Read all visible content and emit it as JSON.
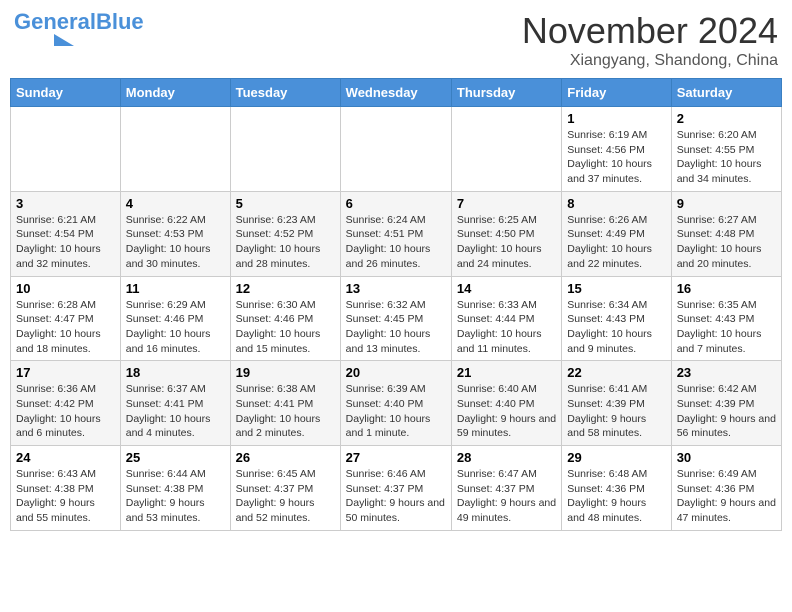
{
  "logo": {
    "general": "General",
    "blue": "Blue",
    "tagline": ""
  },
  "header": {
    "month": "November 2024",
    "location": "Xiangyang, Shandong, China"
  },
  "days_of_week": [
    "Sunday",
    "Monday",
    "Tuesday",
    "Wednesday",
    "Thursday",
    "Friday",
    "Saturday"
  ],
  "weeks": [
    {
      "days": [
        {
          "num": "",
          "info": ""
        },
        {
          "num": "",
          "info": ""
        },
        {
          "num": "",
          "info": ""
        },
        {
          "num": "",
          "info": ""
        },
        {
          "num": "",
          "info": ""
        },
        {
          "num": "1",
          "info": "Sunrise: 6:19 AM\nSunset: 4:56 PM\nDaylight: 10 hours and 37 minutes."
        },
        {
          "num": "2",
          "info": "Sunrise: 6:20 AM\nSunset: 4:55 PM\nDaylight: 10 hours and 34 minutes."
        }
      ]
    },
    {
      "days": [
        {
          "num": "3",
          "info": "Sunrise: 6:21 AM\nSunset: 4:54 PM\nDaylight: 10 hours and 32 minutes."
        },
        {
          "num": "4",
          "info": "Sunrise: 6:22 AM\nSunset: 4:53 PM\nDaylight: 10 hours and 30 minutes."
        },
        {
          "num": "5",
          "info": "Sunrise: 6:23 AM\nSunset: 4:52 PM\nDaylight: 10 hours and 28 minutes."
        },
        {
          "num": "6",
          "info": "Sunrise: 6:24 AM\nSunset: 4:51 PM\nDaylight: 10 hours and 26 minutes."
        },
        {
          "num": "7",
          "info": "Sunrise: 6:25 AM\nSunset: 4:50 PM\nDaylight: 10 hours and 24 minutes."
        },
        {
          "num": "8",
          "info": "Sunrise: 6:26 AM\nSunset: 4:49 PM\nDaylight: 10 hours and 22 minutes."
        },
        {
          "num": "9",
          "info": "Sunrise: 6:27 AM\nSunset: 4:48 PM\nDaylight: 10 hours and 20 minutes."
        }
      ]
    },
    {
      "days": [
        {
          "num": "10",
          "info": "Sunrise: 6:28 AM\nSunset: 4:47 PM\nDaylight: 10 hours and 18 minutes."
        },
        {
          "num": "11",
          "info": "Sunrise: 6:29 AM\nSunset: 4:46 PM\nDaylight: 10 hours and 16 minutes."
        },
        {
          "num": "12",
          "info": "Sunrise: 6:30 AM\nSunset: 4:46 PM\nDaylight: 10 hours and 15 minutes."
        },
        {
          "num": "13",
          "info": "Sunrise: 6:32 AM\nSunset: 4:45 PM\nDaylight: 10 hours and 13 minutes."
        },
        {
          "num": "14",
          "info": "Sunrise: 6:33 AM\nSunset: 4:44 PM\nDaylight: 10 hours and 11 minutes."
        },
        {
          "num": "15",
          "info": "Sunrise: 6:34 AM\nSunset: 4:43 PM\nDaylight: 10 hours and 9 minutes."
        },
        {
          "num": "16",
          "info": "Sunrise: 6:35 AM\nSunset: 4:43 PM\nDaylight: 10 hours and 7 minutes."
        }
      ]
    },
    {
      "days": [
        {
          "num": "17",
          "info": "Sunrise: 6:36 AM\nSunset: 4:42 PM\nDaylight: 10 hours and 6 minutes."
        },
        {
          "num": "18",
          "info": "Sunrise: 6:37 AM\nSunset: 4:41 PM\nDaylight: 10 hours and 4 minutes."
        },
        {
          "num": "19",
          "info": "Sunrise: 6:38 AM\nSunset: 4:41 PM\nDaylight: 10 hours and 2 minutes."
        },
        {
          "num": "20",
          "info": "Sunrise: 6:39 AM\nSunset: 4:40 PM\nDaylight: 10 hours and 1 minute."
        },
        {
          "num": "21",
          "info": "Sunrise: 6:40 AM\nSunset: 4:40 PM\nDaylight: 9 hours and 59 minutes."
        },
        {
          "num": "22",
          "info": "Sunrise: 6:41 AM\nSunset: 4:39 PM\nDaylight: 9 hours and 58 minutes."
        },
        {
          "num": "23",
          "info": "Sunrise: 6:42 AM\nSunset: 4:39 PM\nDaylight: 9 hours and 56 minutes."
        }
      ]
    },
    {
      "days": [
        {
          "num": "24",
          "info": "Sunrise: 6:43 AM\nSunset: 4:38 PM\nDaylight: 9 hours and 55 minutes."
        },
        {
          "num": "25",
          "info": "Sunrise: 6:44 AM\nSunset: 4:38 PM\nDaylight: 9 hours and 53 minutes."
        },
        {
          "num": "26",
          "info": "Sunrise: 6:45 AM\nSunset: 4:37 PM\nDaylight: 9 hours and 52 minutes."
        },
        {
          "num": "27",
          "info": "Sunrise: 6:46 AM\nSunset: 4:37 PM\nDaylight: 9 hours and 50 minutes."
        },
        {
          "num": "28",
          "info": "Sunrise: 6:47 AM\nSunset: 4:37 PM\nDaylight: 9 hours and 49 minutes."
        },
        {
          "num": "29",
          "info": "Sunrise: 6:48 AM\nSunset: 4:36 PM\nDaylight: 9 hours and 48 minutes."
        },
        {
          "num": "30",
          "info": "Sunrise: 6:49 AM\nSunset: 4:36 PM\nDaylight: 9 hours and 47 minutes."
        }
      ]
    }
  ]
}
